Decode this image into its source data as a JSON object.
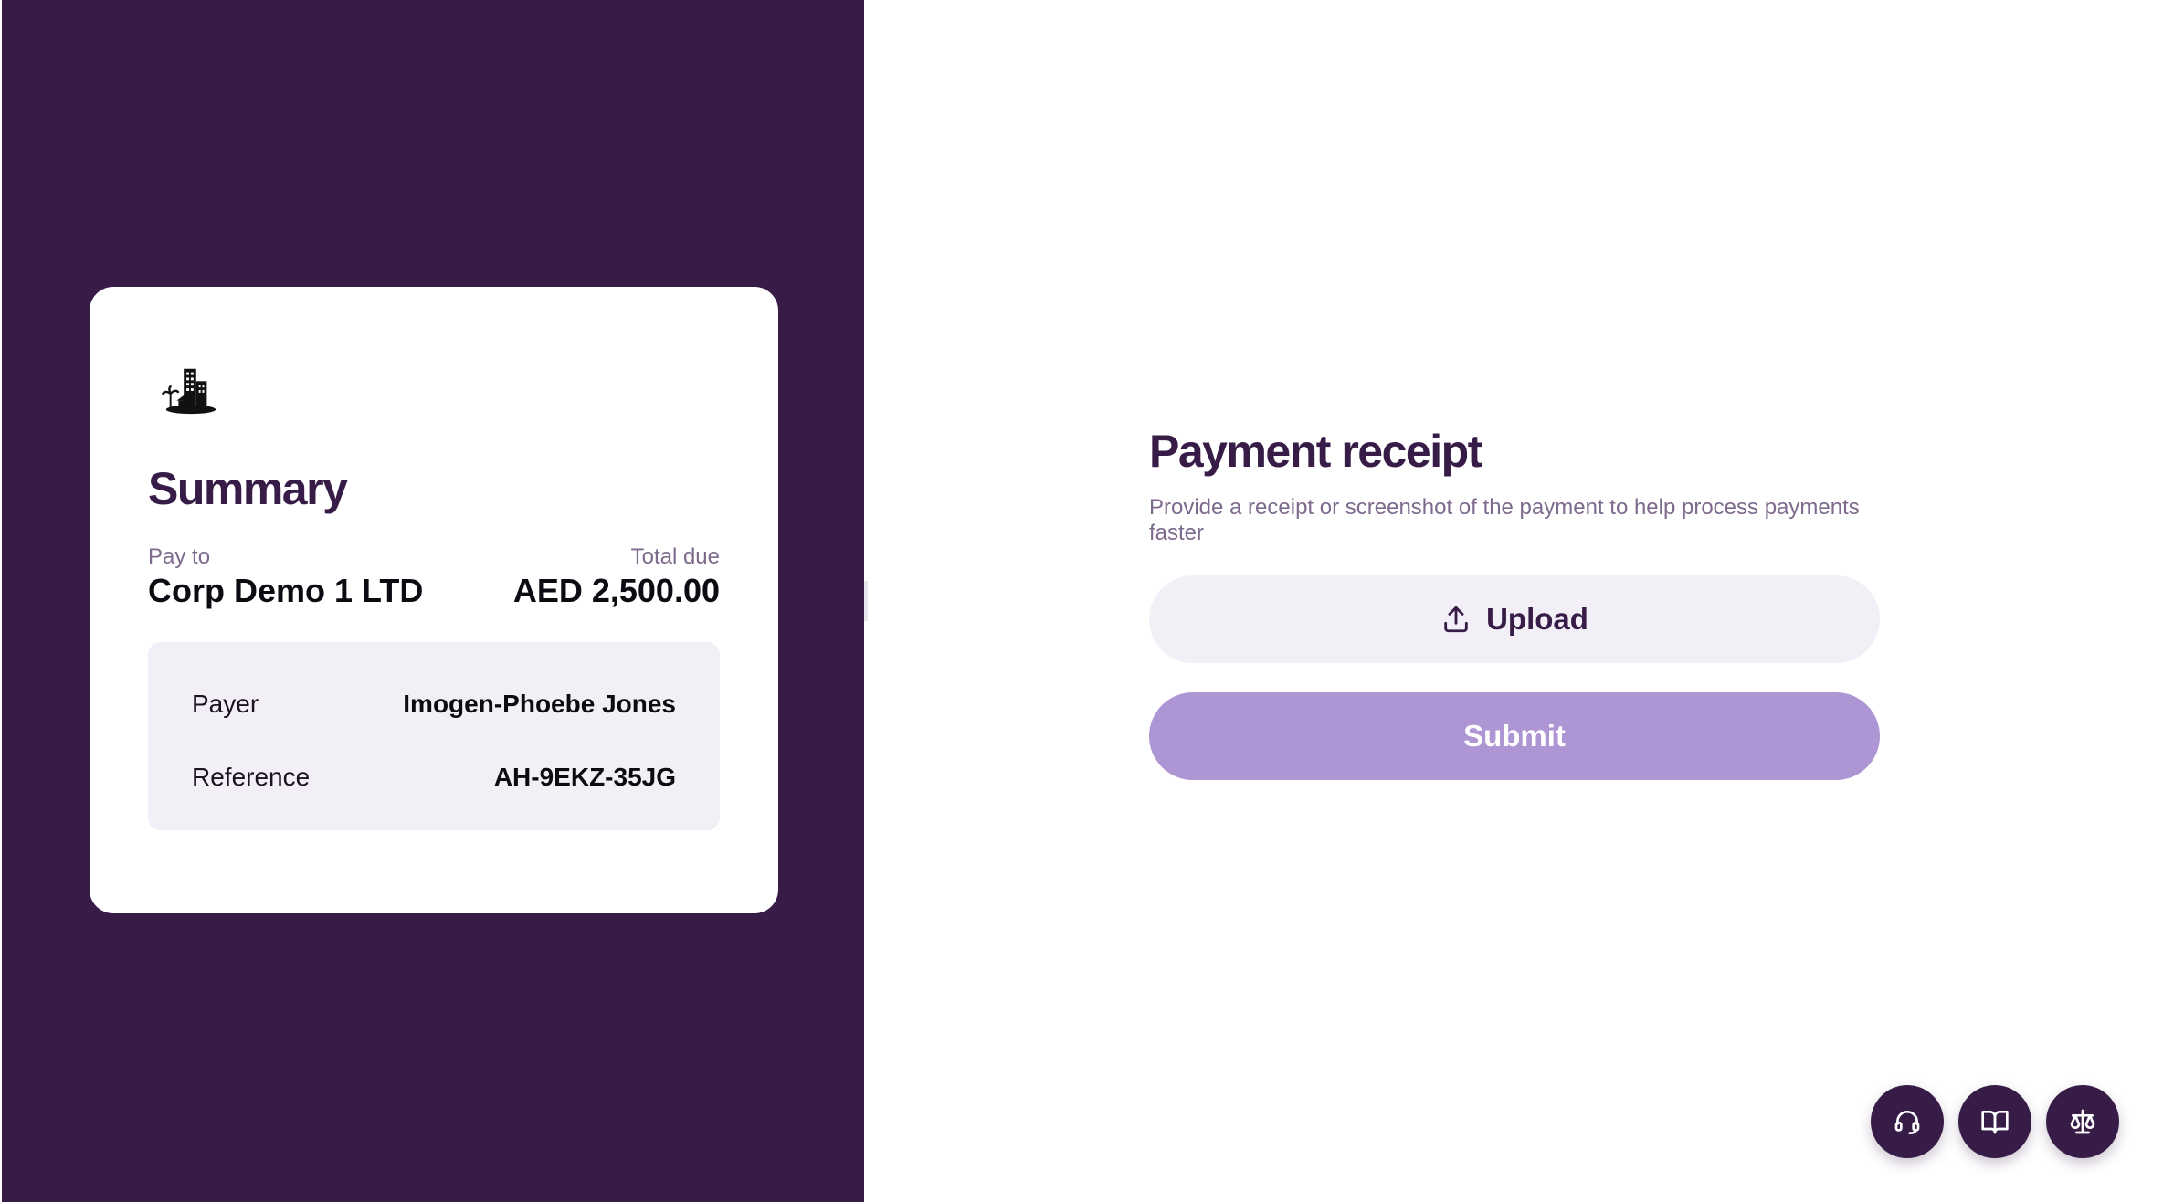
{
  "summary": {
    "title": "Summary",
    "pay_to_label": "Pay to",
    "pay_to_value": "Corp Demo 1 LTD",
    "total_due_label": "Total due",
    "total_due_value": "AED 2,500.00",
    "details": [
      {
        "label": "Payer",
        "value": "Imogen-Phoebe Jones"
      },
      {
        "label": "Reference",
        "value": "AH-9EKZ-35JG"
      }
    ],
    "logo_icon": "building-logo-icon"
  },
  "receipt": {
    "title": "Payment receipt",
    "description": "Provide a receipt or screenshot of the payment to help process payments faster",
    "upload_label": "Upload",
    "submit_label": "Submit"
  },
  "fabs": [
    {
      "icon": "headset-icon"
    },
    {
      "icon": "book-icon"
    },
    {
      "icon": "scales-icon"
    }
  ],
  "colors": {
    "brand": "#361c47",
    "accent": "#ae95d4",
    "muted_text": "#7d6a8c",
    "soft_bg": "#f2eff6"
  }
}
